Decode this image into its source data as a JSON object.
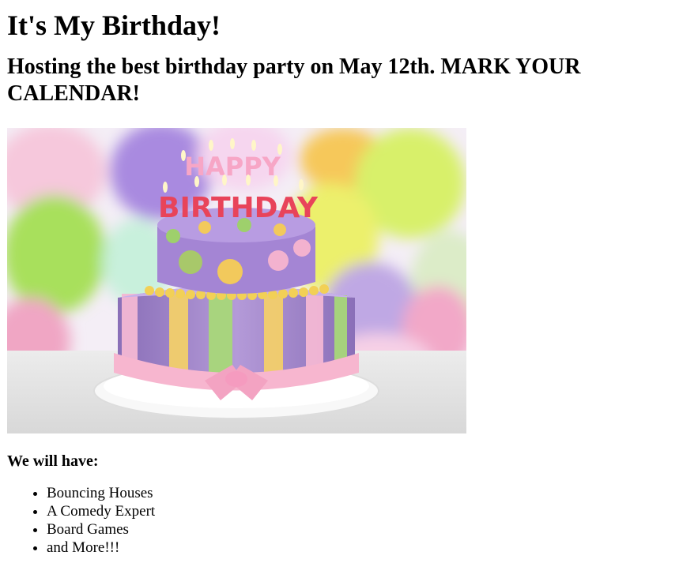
{
  "header": {
    "title": "It's My Birthday!",
    "subtitle": "Hosting the best birthday party on May 12th. MARK YOUR CALENDAR!"
  },
  "image": {
    "alt": "Birthday cake",
    "cake_text": "HAPPY BIRTHDAY"
  },
  "activities": {
    "heading": "We will have:",
    "items": [
      "Bouncing Houses",
      "A Comedy Expert",
      "Board Games",
      "and More!!!"
    ]
  }
}
